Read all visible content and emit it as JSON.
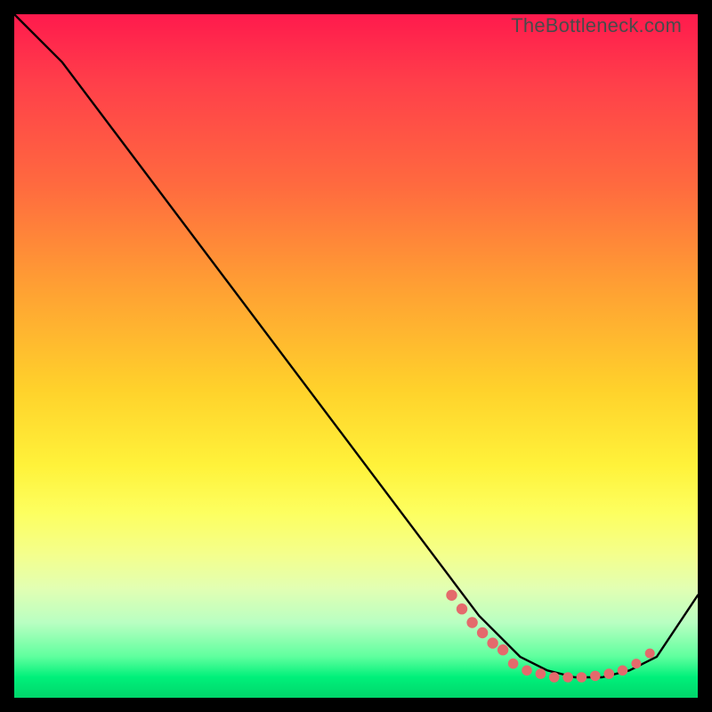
{
  "watermark": "TheBottleneck.com",
  "colors": {
    "background": "#000000",
    "gradient_top": "#ff1a4d",
    "gradient_mid": "#fff23a",
    "gradient_bottom": "#00d66b",
    "curve": "#000000",
    "dots": "#e46a6c"
  },
  "chart_data": {
    "type": "line",
    "title": "",
    "xlabel": "",
    "ylabel": "",
    "xlim": [
      0,
      100
    ],
    "ylim": [
      0,
      100
    ],
    "grid": false,
    "legend": false,
    "series": [
      {
        "name": "curve",
        "x": [
          0,
          7,
          68,
          74,
          78,
          82,
          86,
          90,
          94,
          100
        ],
        "y": [
          100,
          93,
          12,
          6,
          4,
          3,
          3,
          4,
          6,
          15
        ]
      }
    ],
    "markers": [
      {
        "name": "dense-dots-left",
        "x": [
          64,
          65.5,
          67,
          68.5,
          70,
          71.5
        ],
        "y": [
          15,
          13,
          11,
          9.5,
          8,
          7
        ]
      },
      {
        "name": "flat-dots",
        "x": [
          73,
          75,
          77,
          79,
          81,
          83,
          85,
          87,
          89
        ],
        "y": [
          5,
          4,
          3.5,
          3,
          3,
          3,
          3.2,
          3.5,
          4
        ]
      },
      {
        "name": "sparse-dots-right",
        "x": [
          91,
          93
        ],
        "y": [
          5,
          6.5
        ]
      }
    ]
  }
}
